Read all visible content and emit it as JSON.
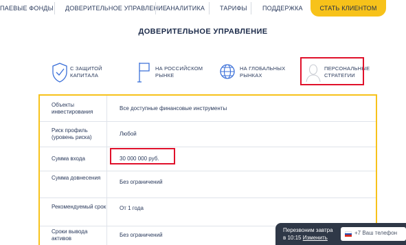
{
  "topnav": {
    "items": [
      {
        "label": "ПАЕВЫЕ ФОНДЫ"
      },
      {
        "label": "ДОВЕРИТЕЛЬНОЕ УПРАВЛЕНИЕ"
      },
      {
        "label": "АНАЛИТИКА"
      },
      {
        "label": "ТАРИФЫ"
      },
      {
        "label": "ПОДДЕРЖКА"
      }
    ],
    "cta_label": "СТАТЬ КЛИЕНТОМ"
  },
  "page_title": "ДОВЕРИТЕЛЬНОЕ УПРАВЛЕНИЕ",
  "features": [
    {
      "icon": "shield-check-icon",
      "line1": "С ЗАЩИТОЙ",
      "line2": "КАПИТАЛА"
    },
    {
      "icon": "flag-icon",
      "line1": "НА РОССИЙСКОМ",
      "line2": "РЫНКЕ"
    },
    {
      "icon": "globe-icon",
      "line1": "НА ГЛОБАЛЬНЫХ",
      "line2": "РЫНКАХ"
    },
    {
      "icon": "person-icon",
      "line1": "ПЕРСОНАЛЬНЫЕ",
      "line2": "СТРАТЕГИИ",
      "highlighted": true
    }
  ],
  "table": {
    "rows": [
      {
        "label": "Объекты инвестирования",
        "value": "Все доступные финансовые инструменты"
      },
      {
        "label": "Риск профиль (уровень риска)",
        "value": "Любой"
      },
      {
        "label": "Сумма входа",
        "value": "30 000 000 руб.",
        "highlighted": true
      },
      {
        "label": "Сумма довнесения",
        "value": "Без ограничений"
      },
      {
        "label": "Рекомендуемый срок",
        "value": "От 1 года"
      },
      {
        "label": "Сроки вывода активов",
        "value": "Без ограничений"
      }
    ]
  },
  "callback": {
    "line1": "Перезвоним завтра",
    "line2_prefix": "в 10:15",
    "change_link": "Изменить",
    "phone_placeholder": "+7 Ваш телефон"
  },
  "colors": {
    "accent_yellow": "#f7c21a",
    "highlight_red": "#e0102a",
    "text_dark": "#1c2b4a",
    "widget_dark": "#2f3847"
  }
}
